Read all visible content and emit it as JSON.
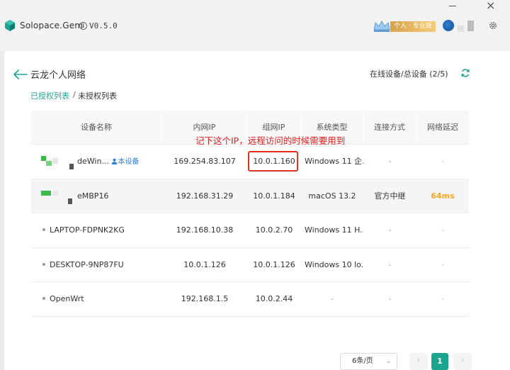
{
  "app": {
    "name": "Solopace.Gem",
    "version": "V0.5.0",
    "info_glyph": "i",
    "minimize_icon": "minimize-icon",
    "close_glyph": "×",
    "vip_label": "个人 · 专业版"
  },
  "network": {
    "title": "云龙个人网络",
    "online_count": "在线设备/总设备 (2/5)",
    "tabs": {
      "authorized": "已授权列表",
      "separator": "/",
      "unauthorized": "未授权列表"
    }
  },
  "table": {
    "headers": [
      "设备名称",
      "内网IP",
      "组网IP",
      "系统类型",
      "连接方式",
      "网络延迟"
    ],
    "rows": [
      {
        "name": "deWin...",
        "this_device": "本设备",
        "lan_ip": "169.254.83.107",
        "mesh_ip": "10.0.1.160",
        "os": "Windows 11 企...",
        "conn": "-",
        "latency": "-"
      },
      {
        "name": "eMBP16",
        "this_device": "",
        "lan_ip": "192.168.31.29",
        "mesh_ip": "10.0.1.184",
        "os": "macOS 13.2",
        "conn": "官方中继",
        "latency": "64ms"
      },
      {
        "name": "LAPTOP-FDPNK2KG",
        "this_device": "",
        "lan_ip": "192.168.10.38",
        "mesh_ip": "10.0.2.70",
        "os": "Windows 11 H...",
        "conn": "-",
        "latency": "-"
      },
      {
        "name": "DESKTOP-9NP87FU",
        "this_device": "",
        "lan_ip": "10.0.1.126",
        "mesh_ip": "10.0.1.126",
        "os": "Windows 10 lo...",
        "conn": "-",
        "latency": "-"
      },
      {
        "name": "OpenWrt",
        "this_device": "",
        "lan_ip": "192.168.1.5",
        "mesh_ip": "10.0.2.44",
        "os": "-",
        "conn": "-",
        "latency": "-"
      }
    ]
  },
  "annotation": {
    "text": "记下这个IP，远程访问的时候需要用到"
  },
  "pagination": {
    "page_size": "6条/页",
    "current": "1",
    "prev_glyph": "‹",
    "next_glyph": "›",
    "dropdown_glyph": "⌄"
  },
  "colors": {
    "accent": "#1aa58f",
    "annotation": "#e02020",
    "latency_ok": "#f5a623",
    "self_link": "#2d7fd6"
  }
}
